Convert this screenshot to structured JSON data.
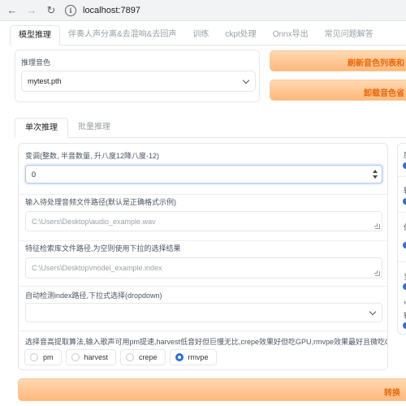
{
  "browser": {
    "back_icon": "arrow-left-icon",
    "forward_icon": "arrow-right-icon",
    "reload_icon": "reload-icon",
    "url": "localhost:7897"
  },
  "top_tabs": [
    {
      "label": "模型推理",
      "active": true
    },
    {
      "label": "伴奏人声分离&去混响&去回声",
      "active": false
    },
    {
      "label": "训练",
      "active": false
    },
    {
      "label": "ckpt处理",
      "active": false
    },
    {
      "label": "Onnx导出",
      "active": false
    },
    {
      "label": "常见问题解答",
      "active": false
    }
  ],
  "inference": {
    "voice_label": "推理音色",
    "voice_value": "mytest.pth",
    "refresh_button": "刷新音色列表和",
    "unload_button": "卸载音色省"
  },
  "inner_tabs": [
    {
      "label": "单次推理",
      "active": true
    },
    {
      "label": "批量推理",
      "active": false
    }
  ],
  "form": {
    "transpose_label": "变调(整数, 半音数量, 升八度12降八度-12)",
    "transpose_value": "0",
    "audio_path_label": "输入待处理音频文件路径(默认是正确格式示例)",
    "audio_path_placeholder": "C:\\Users\\Desktop\\audio_example.wav",
    "index_path_label": "特征检索库文件路径,为空则使用下拉的选择结果",
    "index_path_placeholder": "C:\\Users\\Desktop\\model_example.index",
    "auto_index_label": "自动检测index路径,下拉式选择(dropdown)",
    "f0_label": "选择音高提取算法,输入歌声可用pm提速,harvest低音好但巨慢无比,crepe效果好但吃GPU,rmvpe效果最好且微吃GPU",
    "f0_options": [
      {
        "label": "pm",
        "checked": false
      },
      {
        "label": "harvest",
        "checked": false
      },
      {
        "label": "crepe",
        "checked": false
      },
      {
        "label": "rmvpe",
        "checked": true
      }
    ]
  },
  "right_column": {
    "chars": [
      "度",
      "转",
      "保",
      "当",
      "»",
      "输"
    ]
  },
  "convert_button": "转换",
  "colors": {
    "accent_orange": "#e8680c",
    "radio_blue": "#2f6fe0"
  }
}
